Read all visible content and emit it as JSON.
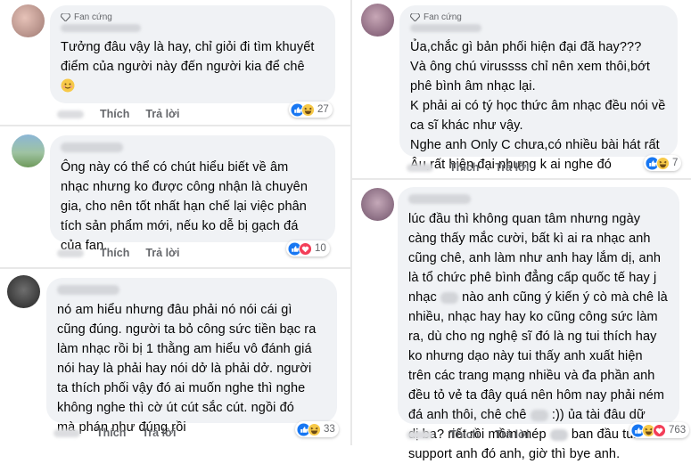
{
  "badge_label": "Fan cứng",
  "action_like": "Thích",
  "action_reply": "Trả lời",
  "comments": [
    {
      "text": "Tưởng đâu vậy là hay, chỉ giỏi đi tìm khuyết\nđiểm của người này đến người kia để chê",
      "reaction_count": "27",
      "reactions": [
        "like-icon",
        "haha-icon"
      ],
      "trailing_emoji": "smiling-face-icon"
    },
    {
      "text": "Ông này có thể có chút hiểu biết về âm\nnhạc nhưng ko được công nhận là chuyên\ngia, cho nên tốt nhất hạn chế lại việc phân\ntích sản phẩm mới, nếu ko dễ bị gạch đá\ncủa fan.",
      "reaction_count": "10",
      "reactions": [
        "like-icon",
        "love-icon"
      ]
    },
    {
      "text": "nó am hiểu nhưng đâu phải nó nói cái gì\ncũng đúng. người ta bỏ công sức tiền bạc ra\nlàm nhạc rồi bị 1 thằng am hiểu vô đánh giá\nnói hay là phải hay nói dở là phải dở. người\nta thích phối vậy đó ai muốn nghe thì nghe\nkhông nghe thì cờ út cút sắc cút. ngồi đó\nmà phán như đúng rồi",
      "reaction_count": "33",
      "reactions": [
        "like-icon",
        "haha-icon"
      ]
    },
    {
      "text": "Ủa,chắc gì bản phối hiện đại đã hay???\nVà ông chú virussss chỉ nên xem thôi,bớt\nphê bình âm nhạc lại.\nK phải ai có tý học thức âm nhạc đều nói về\nca sĩ khác như vậy.\nNghe anh Only C chưa,có nhiều bài hát rất\nÂu,rất hiện đại nhưng k ai nghe đó",
      "reaction_count": "7",
      "reactions": [
        "like-icon",
        "haha-icon"
      ]
    },
    {
      "text_parts": [
        "lúc đầu thì không quan tâm nhưng ngày\ncàng thấy mắc cười, bất kì ai ra nhạc anh\ncũng chê, anh làm như anh hay lắm dị, anh\nlà tổ chức phê bình đẳng cấp quốc tế hay j\nnhạc ",
        " nào anh cũng ý kiến ý cò mà chê là\nnhiều, nhạc hay hay ko cũng công sức làm\nra, dù cho ng nghệ sĩ đó là ng tui thích hay\nko nhưng dạo này tui thấy anh xuất hiện\ntrên các trang mạng nhiều và đa phần anh\nđều tỏ vẻ ta đây quá nên hôm nay phải ném\nđá anh thôi, chê chê ",
        " :)) ủa tài đâu dữ\ndị ba? riết rồi mồm mép ",
        " ban đầu tui\nsupport anh đó anh, giờ thì bye anh."
      ],
      "reaction_count": "763",
      "reactions": [
        "like-icon",
        "haha-icon",
        "love-icon"
      ]
    }
  ]
}
